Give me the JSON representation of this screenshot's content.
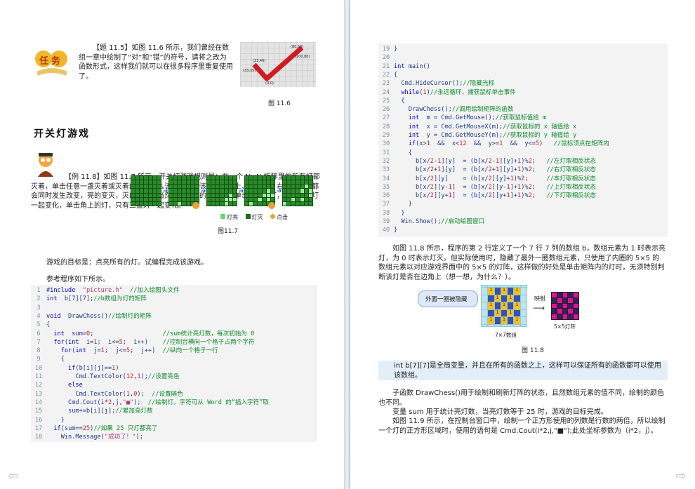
{
  "left_page": {
    "task_badge": "任务",
    "task_text": "【题 11.5】如图 11.6 所示，我们曾经在数组一章中绘制了“对”和“错”的符号，请将之改为函数形式，这样我们就可以在很多程序里重复使用了。",
    "fig116": {
      "points": [
        "(23,40)",
        "(33,35)",
        "(80,50)",
        "(100,80)",
        "(0,0)"
      ],
      "caption": "图 11.6"
    },
    "section_title": "开关灯游戏",
    "example_text": "【例 11.8】如图 11.7 所示，开关灯游戏规则是：在一个 N×N 矩阵里的所有灯都灭着，单击任意一盏灭着或灭着的灯，那么该灯以及与该灯相邻的上、下、左、右共五盏灯都会同时发生改变，亮的变灭，灭的变亮，当然由于边角的特殊性，单击边上的灯，只有四盏灯一起变化，单击角上的灯，只有三盏灯一起变化。",
    "goal_text": "游戏的目标是：点亮所有的灯。试编程完成该游戏。",
    "fig117": {
      "legend": [
        "灯亮",
        "灯灭",
        "点击"
      ],
      "legend_colors": [
        "#6bd96b",
        "#1f6b1f",
        "#e8a23a"
      ],
      "caption": "图11.7"
    },
    "ref_text": "参考程序如下所示。",
    "code": [
      {
        "n": "1",
        "t": "#include  \"picture.h\"  //加入绘图头文件"
      },
      {
        "n": "2",
        "t": "int  b[7][7];//b数组为灯的矩阵"
      },
      {
        "n": "3",
        "t": ""
      },
      {
        "n": "4",
        "t": "void  DrawChess()//绘制灯的矩阵"
      },
      {
        "n": "5",
        "t": "{"
      },
      {
        "n": "6",
        "t": "  int  sum=0;                   //sum统计亮灯数，每次初始为 0"
      },
      {
        "n": "7",
        "t": "  for(int  i=1;  i<=5;  i++)    //控制台横向一个格子占两个字符"
      },
      {
        "n": "8",
        "t": "    for(int  j=1;  j<=5;  j++)  //纵向一个格子一行"
      },
      {
        "n": "9",
        "t": "    {"
      },
      {
        "n": "10",
        "t": "      if(b[i][j]==1)"
      },
      {
        "n": "11",
        "t": "        Cmd.TextColor(12,1);//设置亮色"
      },
      {
        "n": "12",
        "t": "      else"
      },
      {
        "n": "13",
        "t": "        Cmd.TextColor(1,0);  //设置暗色"
      },
      {
        "n": "14",
        "t": "      Cmd.Cout(i*2,j,\"■\");  //绘制灯，字符可从 Word 的“插入字符”取"
      },
      {
        "n": "15",
        "t": "      sum+=b[i][j];//累加亮灯数"
      },
      {
        "n": "16",
        "t": "    }"
      },
      {
        "n": "17",
        "t": "  if(sum==25)//如果 25 只灯都亮了"
      },
      {
        "n": "18",
        "t": "    Win.Message(\"成功了！\");"
      }
    ]
  },
  "right_page": {
    "code": [
      {
        "n": "19",
        "t": "}"
      },
      {
        "n": "20",
        "t": ""
      },
      {
        "n": "21",
        "t": "int main()"
      },
      {
        "n": "22",
        "t": "{"
      },
      {
        "n": "23",
        "t": "  Cmd.HideCursor();//隐藏光标"
      },
      {
        "n": "24",
        "t": "  while(1)//永远循环，捕获鼠标单击事件"
      },
      {
        "n": "25",
        "t": "  {"
      },
      {
        "n": "26",
        "t": "    DrawChess();//调用绘制矩阵的函数"
      },
      {
        "n": "27",
        "t": "    int  m = Cmd.GetMouse();//获取鼠标值给 m"
      },
      {
        "n": "28",
        "t": "    int  x = Cmd.GetMouseX(m);//获取鼠标的 x 轴值给 x"
      },
      {
        "n": "29",
        "t": "    int  y = Cmd.GetMouseY(m);//获取鼠标的 y 轴值给 y"
      },
      {
        "n": "30",
        "t": "    if(x>1  &&  x<12  &&  y>=1  &&  y<=5)   //鼠标须点在矩阵内"
      },
      {
        "n": "31",
        "t": "    {"
      },
      {
        "n": "32",
        "t": "      b[x/2-1][y]  = (b[x/2-1][y]+1)%2;   //左灯取相反状态"
      },
      {
        "n": "33",
        "t": "      b[x/2+1][y]  = (b[x/2+1][y]+1)%2;   //右灯取相反状态"
      },
      {
        "n": "34",
        "t": "      b[x/2][y]    = (b[x/2][y]+1)%2;     //本灯取相反状态"
      },
      {
        "n": "35",
        "t": "      b[x/2][y-1]  = (b[x/2][y-1]+1)%2;   //上灯取相反状态"
      },
      {
        "n": "36",
        "t": "      b[x/2][y+1]  = (b[x/2][y+1]+1)%2;   //下灯取相反状态"
      },
      {
        "n": "37",
        "t": "    }"
      },
      {
        "n": "38",
        "t": "  }"
      },
      {
        "n": "39",
        "t": "  Win.Show();//启动绘图窗口"
      },
      {
        "n": "40",
        "t": "}"
      }
    ],
    "para1": "如图 11.8 所示，程序的第 2 行定义了一个 7 行 7 列的数组 b，数组元素为 1 时表示亮灯，为 0 时表示灯灭。但实际使用时，隐藏了最外一圈数组元素，只使用了内圈的 5×5 的数组元素以对应游戏界面中的 5×5 的灯阵，这样做的好处是单击矩阵内的灯时，无须特别判断该灯是否在边角上（想一想，为什么？）。",
    "fig118": {
      "callout": "外面一圈被隐藏",
      "map_label": "映射",
      "left_caption": "7×7数组",
      "right_caption": "5×5灯阵",
      "caption": "图 11.8",
      "one": "1"
    },
    "note": "int b[7][7]是全局变量，并且在所有的函数之上，这样可以保证所有的函数都可以使用该数组。",
    "para2": "子函数 DrawChess()用于绘制和刷新灯阵的状态，且然数组元素的值不同，绘制的颜色也不同。",
    "para3": "变量 sum 用于统计亮灯数，当亮灯数等于 25 时，游戏的目标完成。",
    "para4": "如图 11.9 所示，在控制台窗口中，绘制一个正方形使用的列数是行数的两倍，所以绘制一个灯的正方形区域时，使用的语句是 Cmd.Cout(i*2,j,\"■\");此处坐标参数为（i*2，j）。"
  },
  "nav": {
    "prev": "⇦",
    "next": "⇨"
  }
}
